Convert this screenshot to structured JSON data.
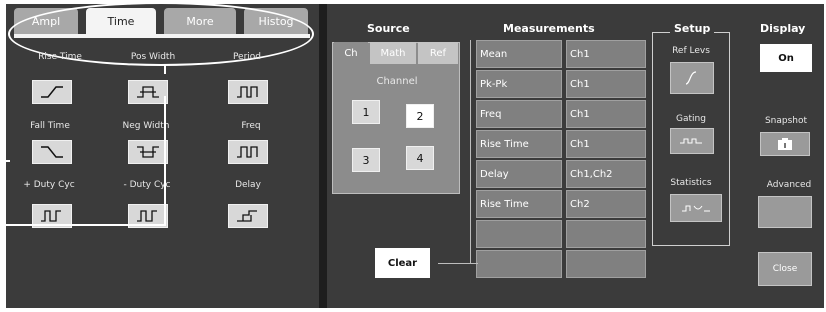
{
  "tabs": [
    "Ampl",
    "Time",
    "More",
    "Histog"
  ],
  "active_tab": "Time",
  "time_measurements": [
    {
      "label": "Rise Time",
      "icon": "rise-time-icon"
    },
    {
      "label": "Pos Width",
      "icon": "pos-width-icon"
    },
    {
      "label": "Period",
      "icon": "period-icon"
    },
    {
      "label": "Fall Time",
      "icon": "fall-time-icon"
    },
    {
      "label": "Neg Width",
      "icon": "neg-width-icon"
    },
    {
      "label": "Freq",
      "icon": "freq-icon"
    },
    {
      "label": "+ Duty Cyc",
      "icon": "pos-duty-cycle-icon"
    },
    {
      "label": "- Duty Cyc",
      "icon": "neg-duty-cycle-icon"
    },
    {
      "label": "Delay",
      "icon": "delay-icon"
    }
  ],
  "source": {
    "header": "Source",
    "tabs": [
      "Ch",
      "Math",
      "Ref"
    ],
    "active_tab": "Ch",
    "group_label": "Channel",
    "channels": [
      {
        "num": "1",
        "selected": false
      },
      {
        "num": "2",
        "selected": true
      },
      {
        "num": "3",
        "selected": false
      },
      {
        "num": "4",
        "selected": false
      }
    ]
  },
  "measurements": {
    "header": "Measurements",
    "rows": [
      {
        "name": "Mean",
        "source": "Ch1"
      },
      {
        "name": "Pk-Pk",
        "source": "Ch1"
      },
      {
        "name": "Freq",
        "source": "Ch1"
      },
      {
        "name": "Rise Time",
        "source": "Ch1"
      },
      {
        "name": "Delay",
        "source": "Ch1,Ch2"
      },
      {
        "name": "Rise Time",
        "source": "Ch2"
      },
      {
        "name": "",
        "source": ""
      },
      {
        "name": "",
        "source": ""
      }
    ],
    "clear_label": "Clear"
  },
  "setup": {
    "header": "Setup",
    "ref_levels_label": "Ref Levs",
    "gating_label": "Gating",
    "statistics_label": "Statistics"
  },
  "display": {
    "header": "Display",
    "on_label": "On",
    "snapshot_label": "Snapshot",
    "advanced_label": "Advanced",
    "close_label": "Close"
  },
  "colors": {
    "panel_bg": "#3b3b3b",
    "button_bg": "#d8d8d8",
    "cell_bg": "#808080",
    "tab_inactive": "#a8a8a8",
    "tab_active": "#f4f4f4"
  }
}
